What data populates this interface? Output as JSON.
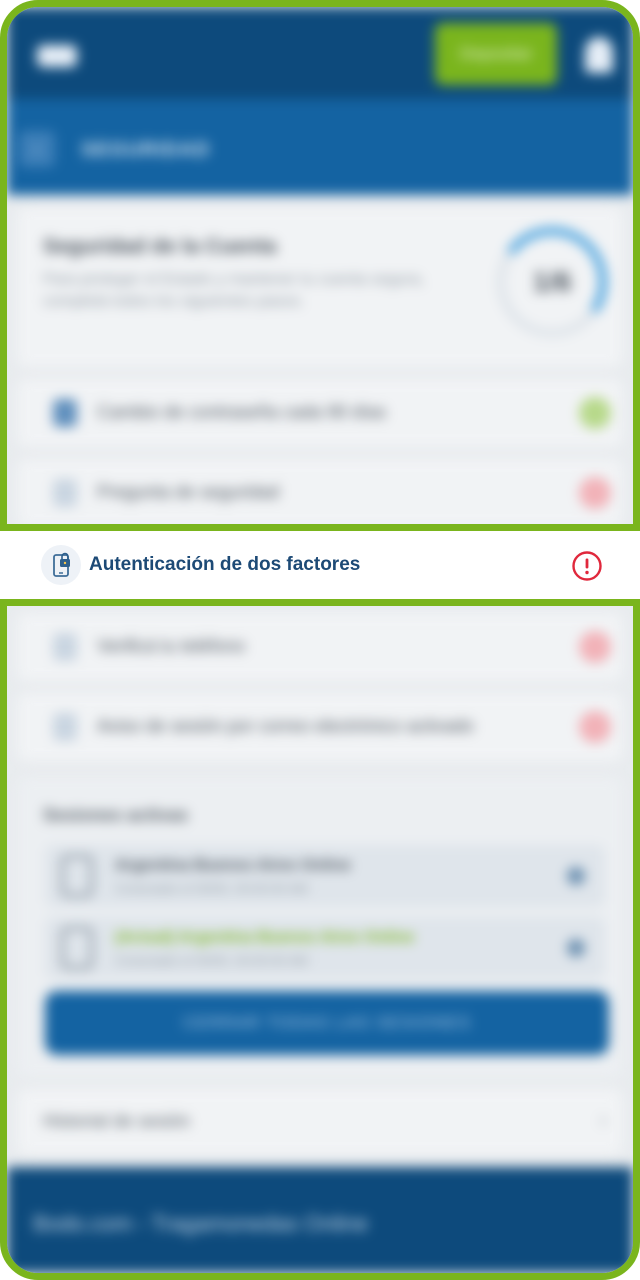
{
  "header": {
    "deposit_label": "Depositar"
  },
  "section": {
    "title": "SEGURIDAD"
  },
  "summary": {
    "title": "Seguridad de la Cuenta",
    "description": "Para proteger el Estado y mantener tu cuenta segura, completá todos los siguientes pasos.",
    "score": "1/6"
  },
  "security_items": [
    {
      "label": "Cambio de contraseña cada 90 días",
      "status": "ok"
    },
    {
      "label": "Pregunta de seguridad",
      "status": "missing"
    },
    {
      "label": "Autenticación de dos factores",
      "status": "missing"
    },
    {
      "label": "Verificá tu teléfono",
      "status": "missing"
    },
    {
      "label": "Aviso de sesión por correo electrónico activado",
      "status": "missing"
    }
  ],
  "sessions": {
    "title": "Sesiones activas",
    "items": [
      {
        "name": "Argentina Buenos Aires Online",
        "detail": "Conectado el 00/00, 00:00:00 AM"
      },
      {
        "name": "(Actual) Argentina Buenos Aires Online",
        "detail": "Conectado el 00/00, 00:00:00 AM"
      }
    ],
    "close_all_label": "CERRAR TODAS LAS SESIONES"
  },
  "history": {
    "label": "Historial de sesión"
  },
  "footer": {
    "text": "Bodo.com - Tragamonedas Online"
  },
  "colors": {
    "frame_green": "#7ab51d",
    "primary_blue": "#1463a2",
    "dark_blue": "#0d4a7c",
    "alert_red": "#e0283c"
  }
}
